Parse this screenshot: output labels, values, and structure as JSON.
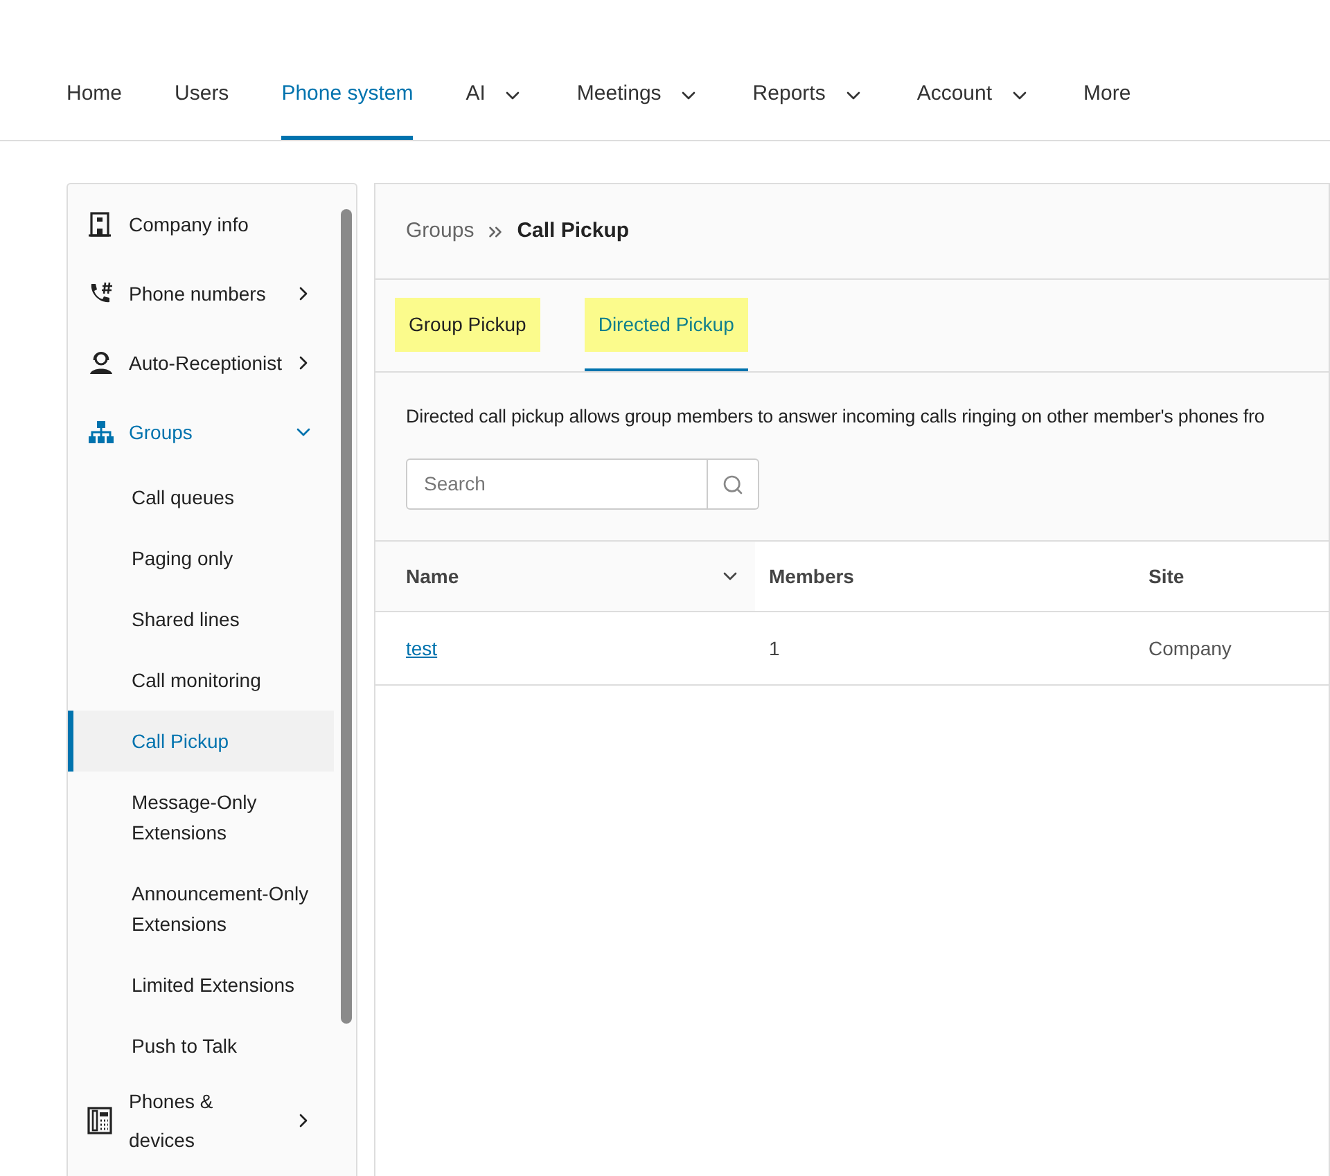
{
  "nav": [
    {
      "label": "Home",
      "selected": false,
      "dropdown": false
    },
    {
      "label": "Users",
      "selected": false,
      "dropdown": false
    },
    {
      "label": "Phone system",
      "selected": true,
      "dropdown": false
    },
    {
      "label": "AI",
      "selected": false,
      "dropdown": true
    },
    {
      "label": "Meetings",
      "selected": false,
      "dropdown": true
    },
    {
      "label": "Reports",
      "selected": false,
      "dropdown": true
    },
    {
      "label": "Account",
      "selected": false,
      "dropdown": true
    },
    {
      "label": "More",
      "selected": false,
      "dropdown": false
    }
  ],
  "sidebar": {
    "items": [
      {
        "label": "Company info",
        "kind": "building",
        "selected": false
      },
      {
        "label": "Phone numbers",
        "kind": "phone",
        "expandable": true,
        "selected": false
      },
      {
        "label": "Auto-Receptionist",
        "kind": "agent",
        "expandable": true,
        "selected": false
      },
      {
        "label": "Groups",
        "kind": "groups",
        "expandable": true,
        "expanded": true,
        "selected": true,
        "children": [
          {
            "label": "Call queues",
            "selected": false
          },
          {
            "label": "Paging only",
            "selected": false
          },
          {
            "label": "Shared lines",
            "selected": false
          },
          {
            "label": "Call monitoring",
            "selected": false
          },
          {
            "label": "Call Pickup",
            "selected": true
          },
          {
            "label": "Message-Only Extensions",
            "selected": false
          },
          {
            "label": "Announcement-Only Extensions",
            "selected": false
          },
          {
            "label": "Limited Extensions",
            "selected": false
          },
          {
            "label": "Push to Talk",
            "selected": false
          }
        ]
      },
      {
        "label": "Phones & devices",
        "kind": "deskphone",
        "expandable": true,
        "selected": false
      }
    ]
  },
  "breadcrumb": {
    "parent": "Groups",
    "current": "Call Pickup"
  },
  "tabs": [
    {
      "label": "Group Pickup",
      "selected": false,
      "highlighted": true
    },
    {
      "label": "Directed Pickup",
      "selected": true,
      "highlighted": true
    }
  ],
  "description": "Directed call pickup allows group members to answer incoming calls ringing on other member's phones fro",
  "search": {
    "placeholder": "Search"
  },
  "table": {
    "columns": [
      {
        "label": "Name",
        "sortable": true
      },
      {
        "label": "Members",
        "sortable": false
      },
      {
        "label": "Site",
        "sortable": false
      }
    ],
    "rows": [
      {
        "name": "test",
        "members": "1",
        "site": "Company"
      }
    ]
  }
}
